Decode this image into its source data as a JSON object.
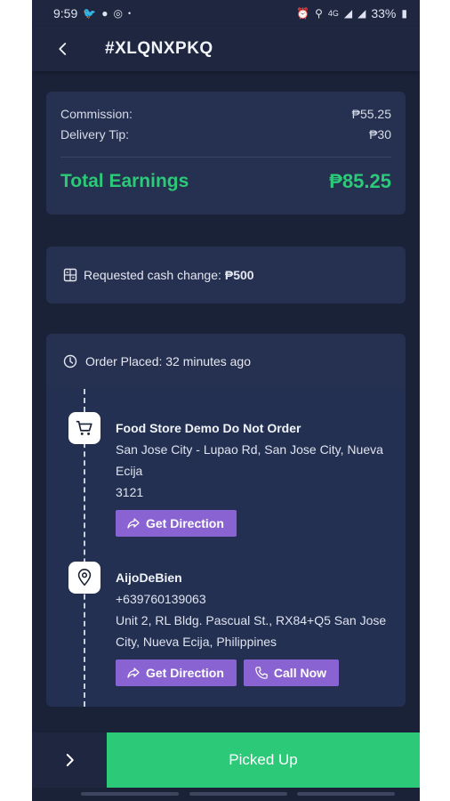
{
  "status_bar": {
    "time": "9:59",
    "battery": "33%",
    "signal_text": "4G"
  },
  "header": {
    "order_id": "#XLQNXPKQ"
  },
  "earnings": {
    "commission_label": "Commission:",
    "commission_value": "₱55.25",
    "tip_label": "Delivery Tip:",
    "tip_value": "₱30",
    "total_label": "Total Earnings",
    "total_value": "₱85.25"
  },
  "cash_change": {
    "label": "Requested cash change:",
    "amount": "₱500"
  },
  "order_placed": {
    "text": "Order Placed: 32 minutes ago"
  },
  "pickup": {
    "name": "Food Store Demo Do Not Order",
    "address_line1": "San Jose City - Lupao Rd, San Jose City, Nueva",
    "address_line2": "Ecija",
    "zip": "3121",
    "direction_label": "Get Direction"
  },
  "dropoff": {
    "name": "AijoDeBien",
    "phone": "+639760139063",
    "address_line1": "Unit 2, RL Bldg. Pascual St., RX84+Q5 San Jose",
    "address_line2": "City, Nueva Ecija, Philippines",
    "direction_label": "Get Direction",
    "call_label": "Call Now"
  },
  "bottom": {
    "action_label": "Picked Up"
  },
  "colors": {
    "background": "#1a2238",
    "card": "#263050",
    "accent_green": "#2bc978",
    "button_purple": "#8a63d2"
  }
}
